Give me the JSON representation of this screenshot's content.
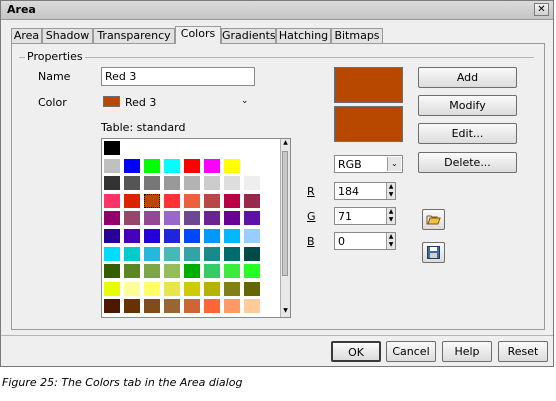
{
  "window": {
    "title": "Area",
    "close_glyph": "✕"
  },
  "tabs": [
    {
      "label": "Area",
      "active": false
    },
    {
      "label": "Shadow",
      "active": false
    },
    {
      "label": "Transparency",
      "active": false
    },
    {
      "label": "Colors",
      "active": true
    },
    {
      "label": "Gradients",
      "active": false
    },
    {
      "label": "Hatching",
      "active": false
    },
    {
      "label": "Bitmaps",
      "active": false
    }
  ],
  "properties": {
    "group_label": "Properties",
    "name_label": "Name",
    "name_value": "Red 3",
    "color_label": "Color",
    "color_value": "Red 3",
    "color_swatch": "#b84700",
    "table_label": "Table: standard"
  },
  "palette": {
    "rows": [
      [
        "#000000"
      ],
      [
        "#c0c0c0",
        "#0000ff",
        "#00ff00",
        "#00ffff",
        "#ff0000",
        "#ff00ff",
        "#ffff00",
        "#ffffff"
      ],
      [
        "#333333",
        "#555555",
        "#777777",
        "#999999",
        "#b3b3b3",
        "#cccccc",
        "#dddddd",
        "#eeeeee"
      ],
      [
        "#ff3366",
        "#dc2300",
        "#b84700",
        "#ff3333",
        "#eb613d",
        "#b84747",
        "#b80047",
        "#99284c"
      ],
      [
        "#94006b",
        "#94476b",
        "#944794",
        "#9966cc",
        "#6b4794",
        "#6b2394",
        "#6b0094",
        "#5e11a6"
      ],
      [
        "#280099",
        "#4700b8",
        "#2300dc",
        "#2323dc",
        "#0047ff",
        "#0099ff",
        "#00b8ff",
        "#99ccff"
      ],
      [
        "#00dcff",
        "#00cccc",
        "#23b8dc",
        "#47b8b8",
        "#33a3a3",
        "#198a8a",
        "#006b6b",
        "#004a4a"
      ],
      [
        "#355e00",
        "#5c8526",
        "#7da647",
        "#94bd5e",
        "#00ae00",
        "#33cc66",
        "#3deb3d",
        "#23ff23"
      ],
      [
        "#e6ff00",
        "#ffff99",
        "#ffff66",
        "#e6e64c",
        "#cccc00",
        "#b3b300",
        "#808019",
        "#666600"
      ],
      [
        "#4c1900",
        "#663300",
        "#804c19",
        "#996633",
        "#cc6633",
        "#ff6633",
        "#ff9966",
        "#ffcc99"
      ]
    ],
    "selected_row": 3,
    "selected_col": 2
  },
  "color_model": {
    "value": "RGB",
    "preview_old": "#b84700",
    "preview_new": "#b84700",
    "fields": [
      {
        "label": "R",
        "value": "184"
      },
      {
        "label": "G",
        "value": "71"
      },
      {
        "label": "B",
        "value": "0"
      }
    ]
  },
  "actions": {
    "add": "Add",
    "modify": "Modify",
    "edit": "Edit...",
    "delete": "Delete..."
  },
  "icons": {
    "load": "folder-open-icon",
    "save": "floppy-save-icon"
  },
  "footer": {
    "ok": "OK",
    "cancel": "Cancel",
    "help": "Help",
    "reset": "Reset"
  },
  "caption": "Figure 25: The Colors tab in the Area dialog"
}
